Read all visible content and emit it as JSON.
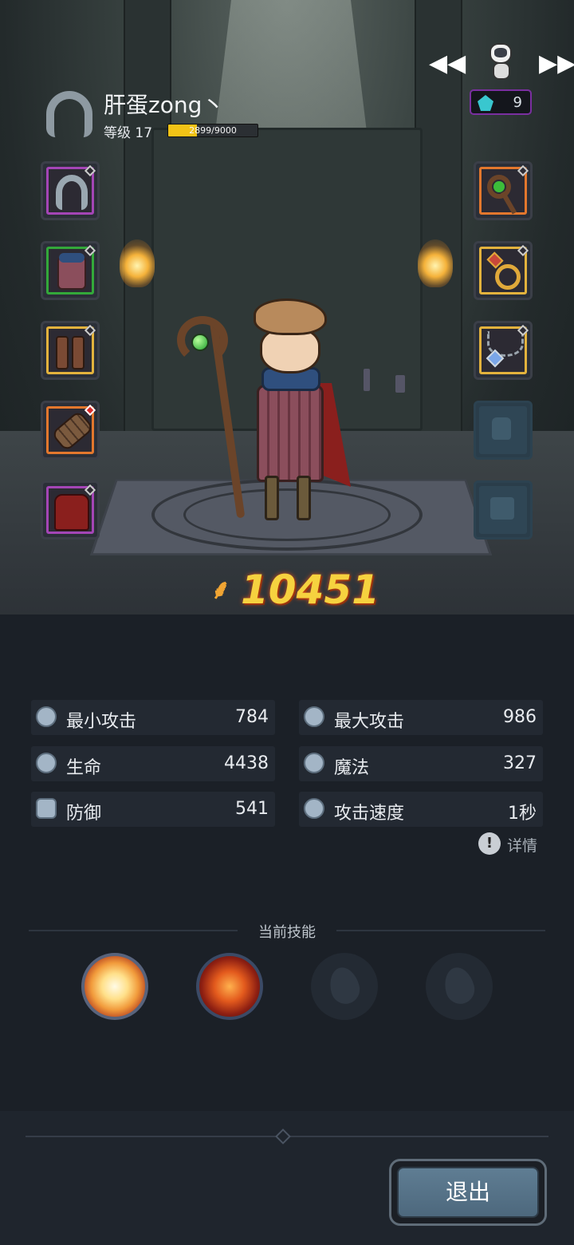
{
  "header": {
    "player_name": "肝蛋zong丶",
    "level_label": "等级 17",
    "xp_text": "2899/9000",
    "xp_fraction": 0.322,
    "currency_value": "9"
  },
  "nav": {
    "prev_glyph": "◀◀",
    "next_glyph": "▶▶"
  },
  "equipment": {
    "left": [
      {
        "name": "hood",
        "rarity": "purple"
      },
      {
        "name": "robe",
        "rarity": "green"
      },
      {
        "name": "boots",
        "rarity": "gold"
      },
      {
        "name": "bracer",
        "rarity": "orange"
      },
      {
        "name": "cape",
        "rarity": "purple"
      }
    ],
    "right": [
      {
        "name": "staff",
        "rarity": "orange"
      },
      {
        "name": "ring",
        "rarity": "gold"
      },
      {
        "name": "necklace",
        "rarity": "gold"
      },
      {
        "name": "locked-slot-1",
        "rarity": "locked"
      },
      {
        "name": "locked-slot-2",
        "rarity": "locked"
      }
    ]
  },
  "power": {
    "value": "10451"
  },
  "stats": [
    {
      "label": "最小攻击",
      "value": "784"
    },
    {
      "label": "最大攻击",
      "value": "986"
    },
    {
      "label": "生命",
      "value": "4438"
    },
    {
      "label": "魔法",
      "value": "327"
    },
    {
      "label": "防御",
      "value": "541"
    },
    {
      "label": "攻击速度",
      "value": "1秒"
    }
  ],
  "details_label": "详情",
  "skills": {
    "title": "当前技能"
  },
  "exit_label": "退出",
  "colors": {
    "background": "#1b2027",
    "power_text": "#f6d23f",
    "xp_fill": "#f2c316",
    "currency_border": "#7a2fa0",
    "exit_button": "#5f7d93"
  }
}
